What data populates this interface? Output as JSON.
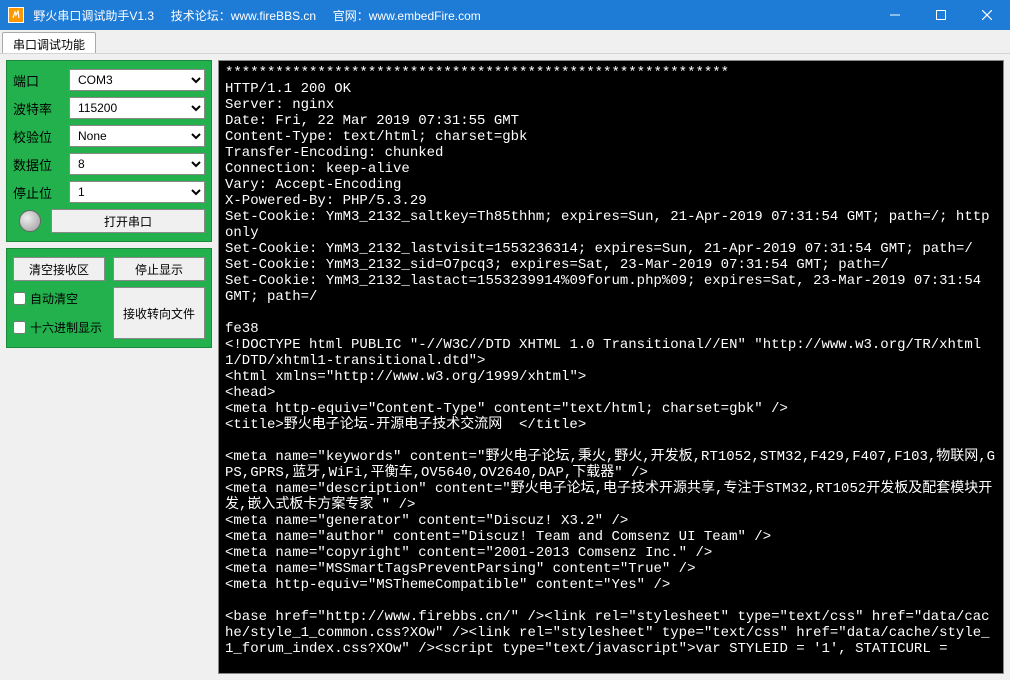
{
  "titlebar": {
    "title": " 野火串口调试助手V1.3",
    "forum_label": "技术论坛：",
    "forum_url": "www.fireBBS.cn",
    "site_label": "官网：",
    "site_url": "www.embedFire.com"
  },
  "tab": {
    "label": "串口调试功能"
  },
  "config": {
    "port_label": "端口",
    "port_value": "COM3",
    "baud_label": "波特率",
    "baud_value": "115200",
    "parity_label": "校验位",
    "parity_value": "None",
    "databits_label": "数据位",
    "databits_value": "8",
    "stopbits_label": "停止位",
    "stopbits_value": "1",
    "open_button": "打开串口"
  },
  "rx_panel": {
    "clear_button": "清空接收区",
    "pause_button": "停止显示",
    "auto_clear": "自动清空",
    "hex_display": "十六进制显示",
    "to_file_button": "接收转向文件"
  },
  "console_text": "************************************************************\nHTTP/1.1 200 OK\nServer: nginx\nDate: Fri, 22 Mar 2019 07:31:55 GMT\nContent-Type: text/html; charset=gbk\nTransfer-Encoding: chunked\nConnection: keep-alive\nVary: Accept-Encoding\nX-Powered-By: PHP/5.3.29\nSet-Cookie: YmM3_2132_saltkey=Th85thhm; expires=Sun, 21-Apr-2019 07:31:54 GMT; path=/; httponly\nSet-Cookie: YmM3_2132_lastvisit=1553236314; expires=Sun, 21-Apr-2019 07:31:54 GMT; path=/\nSet-Cookie: YmM3_2132_sid=O7pcq3; expires=Sat, 23-Mar-2019 07:31:54 GMT; path=/\nSet-Cookie: YmM3_2132_lastact=1553239914%09forum.php%09; expires=Sat, 23-Mar-2019 07:31:54 GMT; path=/\n\nfe38\n<!DOCTYPE html PUBLIC \"-//W3C//DTD XHTML 1.0 Transitional//EN\" \"http://www.w3.org/TR/xhtml1/DTD/xhtml1-transitional.dtd\">\n<html xmlns=\"http://www.w3.org/1999/xhtml\">\n<head>\n<meta http-equiv=\"Content-Type\" content=\"text/html; charset=gbk\" />\n<title>野火电子论坛-开源电子技术交流网  </title>\n\n<meta name=\"keywords\" content=\"野火电子论坛,秉火,野火,开发板,RT1052,STM32,F429,F407,F103,物联网,GPS,GPRS,蓝牙,WiFi,平衡车,OV5640,OV2640,DAP,下载器\" />\n<meta name=\"description\" content=\"野火电子论坛,电子技术开源共享,专注于STM32,RT1052开发板及配套模块开发,嵌入式板卡方案专家 \" />\n<meta name=\"generator\" content=\"Discuz! X3.2\" />\n<meta name=\"author\" content=\"Discuz! Team and Comsenz UI Team\" />\n<meta name=\"copyright\" content=\"2001-2013 Comsenz Inc.\" />\n<meta name=\"MSSmartTagsPreventParsing\" content=\"True\" />\n<meta http-equiv=\"MSThemeCompatible\" content=\"Yes\" />\n\n<base href=\"http://www.firebbs.cn/\" /><link rel=\"stylesheet\" type=\"text/css\" href=\"data/cache/style_1_common.css?XOw\" /><link rel=\"stylesheet\" type=\"text/css\" href=\"data/cache/style_1_forum_index.css?XOw\" /><script type=\"text/javascript\">var STYLEID = '1', STATICURL ="
}
